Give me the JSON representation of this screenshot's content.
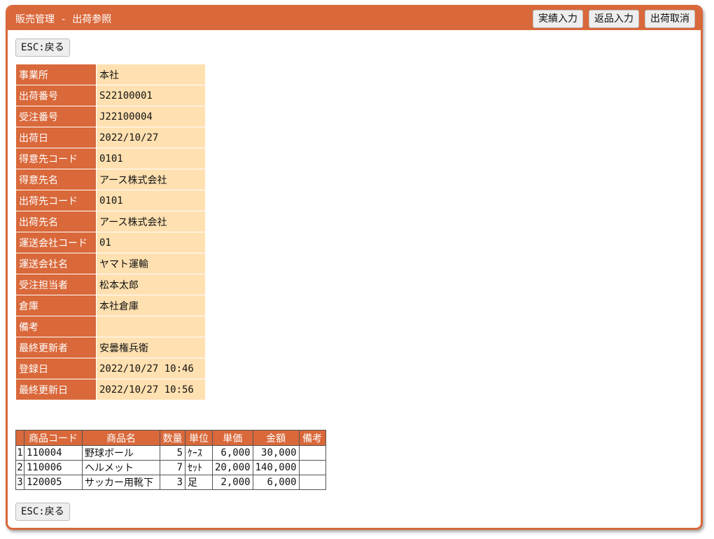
{
  "window": {
    "title": "販売管理 - 出荷参照",
    "buttons": {
      "results_entry": "実績入力",
      "return_entry": "返品入力",
      "cancel_shipment": "出荷取消"
    }
  },
  "esc_button": "ESC:戻る",
  "info": [
    {
      "key": "事業所",
      "value": "本社"
    },
    {
      "key": "出荷番号",
      "value": "S22100001"
    },
    {
      "key": "受注番号",
      "value": "J22100004"
    },
    {
      "key": "出荷日",
      "value": "2022/10/27"
    },
    {
      "key": "得意先コード",
      "value": "0101"
    },
    {
      "key": "得意先名",
      "value": "アース株式会社"
    },
    {
      "key": "出荷先コード",
      "value": "0101"
    },
    {
      "key": "出荷先名",
      "value": "アース株式会社"
    },
    {
      "key": "運送会社コード",
      "value": "01"
    },
    {
      "key": "運送会社名",
      "value": "ヤマト運輸"
    },
    {
      "key": "受注担当者",
      "value": "松本太郎"
    },
    {
      "key": "倉庫",
      "value": "本社倉庫"
    },
    {
      "key": "備考",
      "value": ""
    },
    {
      "key": "最終更新者",
      "value": "安曇権兵衛"
    },
    {
      "key": "登録日",
      "value": "2022/10/27 10:46"
    },
    {
      "key": "最終更新日",
      "value": "2022/10/27 10:56"
    }
  ],
  "items": {
    "headers": [
      "",
      "商品コード",
      "商品名",
      "数量",
      "単位",
      "単価",
      "金額",
      "備考"
    ],
    "rows": [
      {
        "no": "1",
        "code": "110004",
        "name": "野球ボール",
        "qty": "5",
        "unit": "ｹｰｽ",
        "price": "6,000",
        "amount": "30,000",
        "note": ""
      },
      {
        "no": "2",
        "code": "110006",
        "name": "ヘルメット",
        "qty": "7",
        "unit": "ｾｯﾄ",
        "price": "20,000",
        "amount": "140,000",
        "note": ""
      },
      {
        "no": "3",
        "code": "120005",
        "name": "サッカー用靴下",
        "qty": "3",
        "unit": "足",
        "price": "2,000",
        "amount": "6,000",
        "note": ""
      }
    ]
  },
  "colors": {
    "accent": "#d9683a",
    "value_bg": "#ffe0b0"
  }
}
